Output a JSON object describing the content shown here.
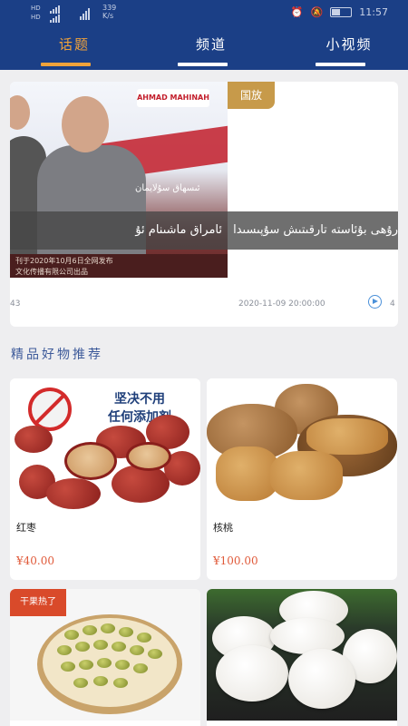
{
  "status_bar": {
    "network_hd_1": "HD",
    "network_hd_2": "HD",
    "speed_value": "339",
    "speed_unit": "K/s",
    "time": "11:57"
  },
  "tabs": [
    {
      "label": "话题",
      "active": true
    },
    {
      "label": "频道",
      "active": false
    },
    {
      "label": "小视频",
      "active": false
    }
  ],
  "carousel": {
    "slide_logo": "AHMAD MAHINAH",
    "slide_sign": "ئىسھاق سۇلايمان",
    "slide_bottom_line1": "刊于2020年10月6日全网发布",
    "slide_bottom_line2": "文化传播有限公司出品",
    "caption_left": "ئامراق ماشىنام ئۇ",
    "caption_right": "رۇھى بۇئاستە تارقىتىش سۇپىسىدا",
    "badge": "国放",
    "meta_left": "43",
    "meta_date": "2020-11-09 20:00:00",
    "meta_right": "4"
  },
  "section": {
    "title": "精品好物推荐"
  },
  "products": [
    {
      "name": "红枣",
      "price": "¥40.00",
      "banner_line1": "坚决不用",
      "banner_line2": "任何添加剂"
    },
    {
      "name": "核桃",
      "price": "¥100.00"
    },
    {
      "name": "",
      "price": "",
      "badge": "干果热了"
    },
    {
      "name": "",
      "price": ""
    }
  ],
  "colors": {
    "header_bg": "#1b3f86",
    "active_tab": "#f0a23a",
    "price": "#e05a3a",
    "badge": "#c79a4a"
  }
}
